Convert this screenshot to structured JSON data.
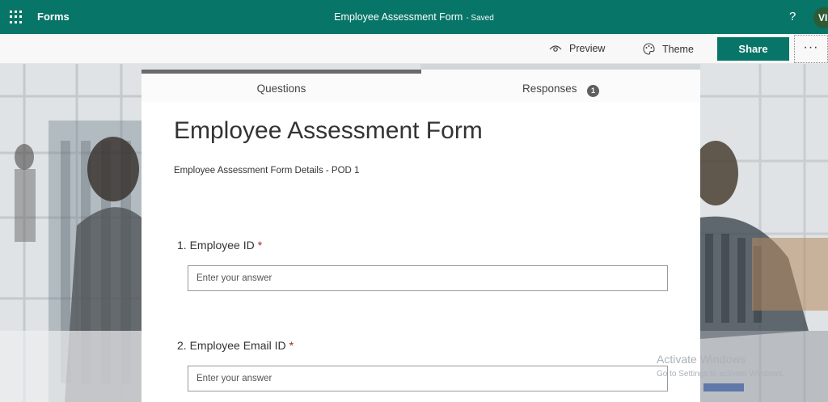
{
  "topbar": {
    "app_name": "Forms",
    "title": "Employee Assessment Form",
    "saved_status": "- Saved",
    "help": "?",
    "avatar_initials": "VI"
  },
  "commands": {
    "preview": "Preview",
    "theme": "Theme",
    "share": "Share",
    "more": "···"
  },
  "tabs": {
    "questions": "Questions",
    "responses": "Responses",
    "responses_count": "1"
  },
  "form": {
    "title": "Employee Assessment Form",
    "description": "Employee Assessment Form Details - POD 1",
    "questions": [
      {
        "number": "1.",
        "label": "Employee ID",
        "required": "*",
        "placeholder": "Enter your answer"
      },
      {
        "number": "2.",
        "label": "Employee Email ID",
        "required": "*",
        "placeholder": "Enter your answer"
      }
    ]
  },
  "watermark": {
    "line1": "Activate Windows",
    "line2": "Go to Settings to activate Windows."
  },
  "colors": {
    "brand": "#077568",
    "required": "#a4262c"
  }
}
